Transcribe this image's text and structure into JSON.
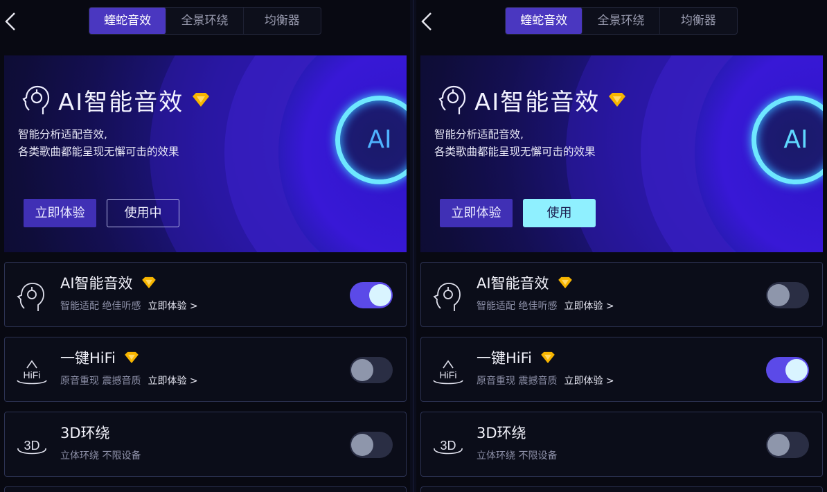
{
  "tabs": [
    "蝰蛇音效",
    "全景环绕",
    "均衡器"
  ],
  "banner": {
    "title": "AI智能音效",
    "desc_line1": "智能分析适配音效,",
    "desc_line2": "各类歌曲都能呈现无懈可击的效果",
    "ai_label": "AI",
    "try_button": "立即体验"
  },
  "left": {
    "use_button": "使用中",
    "toggles": [
      true,
      false,
      false
    ]
  },
  "right": {
    "use_button": "使用",
    "toggles": [
      false,
      true,
      false
    ]
  },
  "cards": [
    {
      "title": "AI智能音效",
      "subtitle": "智能适配 绝佳听感",
      "link": "立即体验 >",
      "vip": true,
      "icon": "ai-head-icon"
    },
    {
      "title": "一键HiFi",
      "subtitle": "原音重现 震撼音质",
      "link": "立即体验 >",
      "vip": true,
      "icon": "hifi-icon",
      "icon_text": "HiFi"
    },
    {
      "title": "3D环绕",
      "subtitle": "立体环绕 不限设备",
      "link": "",
      "vip": false,
      "icon": "3d-icon",
      "icon_text": "3D"
    }
  ],
  "colors": {
    "accent": "#4a37c0",
    "toggle_on": "#5b4ae8",
    "use_filled": "#8ff0ff",
    "vip": "#f7b500"
  }
}
